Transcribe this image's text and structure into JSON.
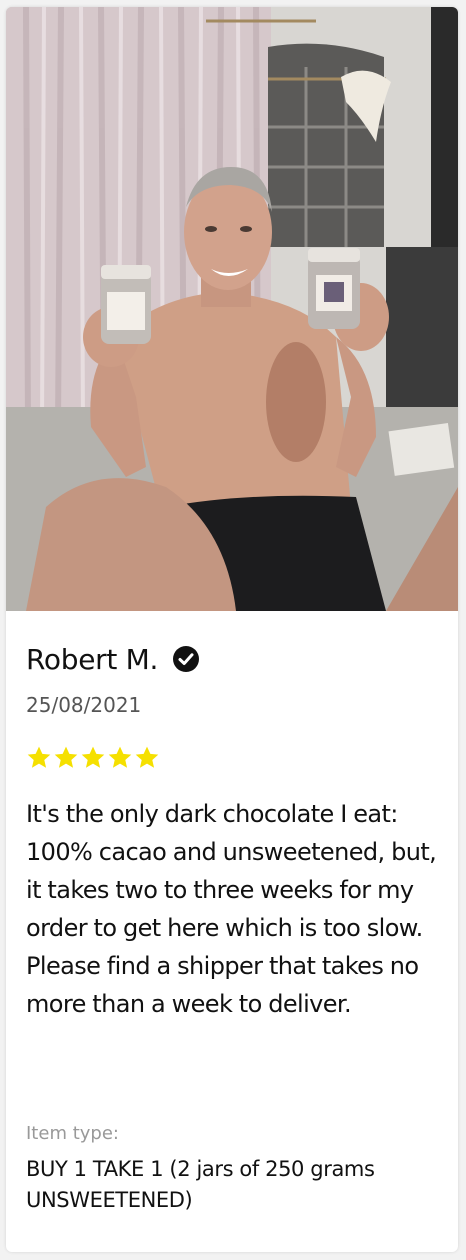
{
  "review": {
    "reviewer_name": "Robert M.",
    "verified_icon": "verified-check-icon",
    "date": "25/08/2021",
    "rating": 5,
    "rating_max": 5,
    "star_color": "#f5e000",
    "text": "It's the only dark chocolate I eat:  100% cacao and unsweetened, but, it takes two to three weeks for my order to get here which is too slow.  Please find a shipper that takes no more than a week to deliver.",
    "item_type_label": "Item type:",
    "item_type_value": "BUY 1 TAKE 1 (2 jars of 250 grams UNSWEETENED)"
  }
}
